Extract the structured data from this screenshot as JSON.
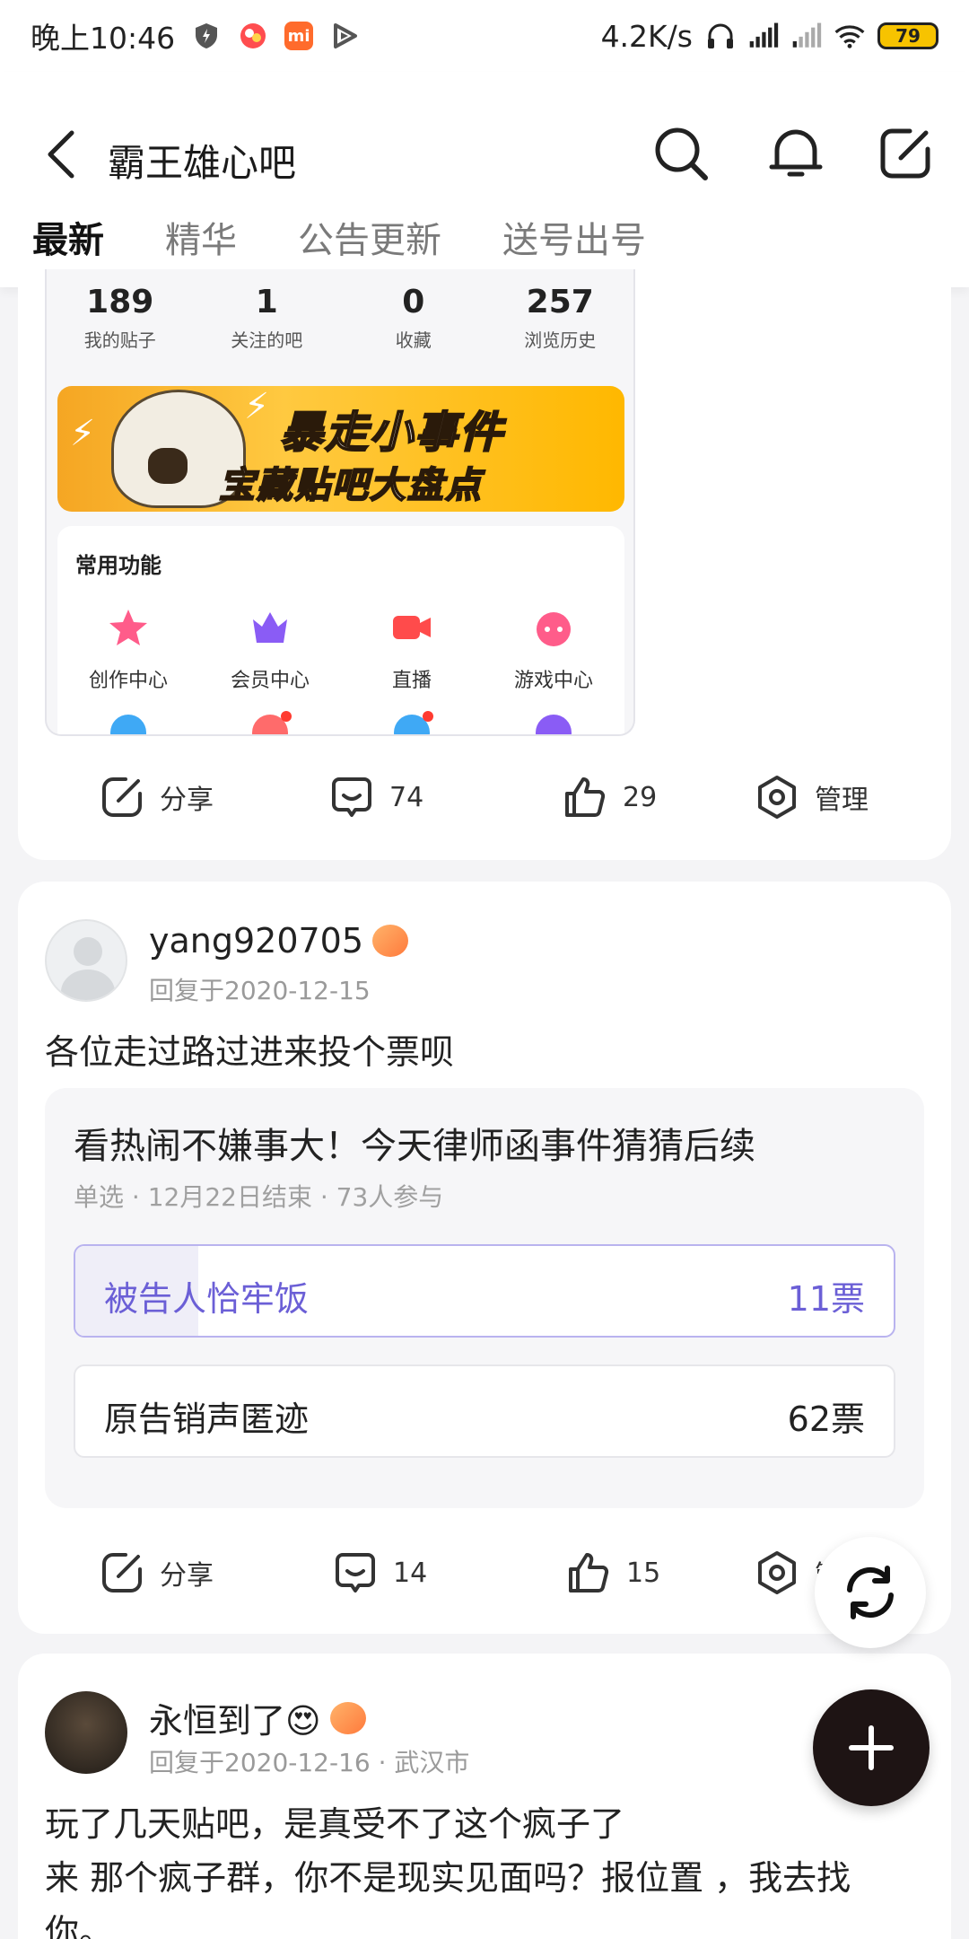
{
  "status_bar": {
    "time": "晚上10:46",
    "net_speed": "4.2K/s",
    "battery": "79",
    "mi_badge": "mi"
  },
  "header": {
    "title": "霸王雄心吧",
    "icons": [
      "back-icon",
      "search-icon",
      "bell-icon",
      "edit-icon"
    ]
  },
  "tabs": [
    {
      "label": "最新",
      "active": true
    },
    {
      "label": "精华",
      "active": false
    },
    {
      "label": "公告更新",
      "active": false
    },
    {
      "label": "送号出号",
      "active": false
    }
  ],
  "post1": {
    "embedded": {
      "stats": [
        {
          "num": "189",
          "label": "我的贴子"
        },
        {
          "num": "1",
          "label": "关注的吧"
        },
        {
          "num": "0",
          "label": "收藏"
        },
        {
          "num": "257",
          "label": "浏览历史"
        }
      ],
      "banner_line1": "暴走小事件",
      "banner_line2": "宝藏贴吧大盘点",
      "funcs_title": "常用功能",
      "funcs": [
        {
          "label": "创作中心",
          "color": "#ff5c8a"
        },
        {
          "label": "会员中心",
          "color": "#8a5cf5"
        },
        {
          "label": "直播",
          "color": "#ff4b4b"
        },
        {
          "label": "游戏中心",
          "color": "#ff5c8a"
        }
      ]
    },
    "actions": {
      "share": "分享",
      "comments": "74",
      "likes": "29",
      "manage": "管理"
    }
  },
  "post2": {
    "username": "yang920705",
    "meta": "回复于2020-12-15",
    "text": "各位走过路过进来投个票呗",
    "poll": {
      "title": "看热闹不嫌事大！今天律师函事件猜猜后续",
      "meta": "单选 · 12月22日结束 · 73人参与",
      "options": [
        {
          "label": "被告人恰牢饭",
          "votes": "11票",
          "selected": true,
          "share": 0.15
        },
        {
          "label": "原告销声匿迹",
          "votes": "62票",
          "selected": false,
          "share": 0.85
        }
      ]
    },
    "actions": {
      "share": "分享",
      "comments": "14",
      "likes": "15",
      "manage": "管"
    }
  },
  "post3": {
    "username": "永恒到了😍",
    "meta": "回复于2020-12-16 · 武汉市",
    "text_line1": "玩了几天贴吧，是真受不了这个疯子了",
    "text_line2": "来 那个疯子群，你不是现实见面吗？报位置 ，我去找",
    "text_line3": "你。"
  },
  "accent_color": "#6b5fd6"
}
